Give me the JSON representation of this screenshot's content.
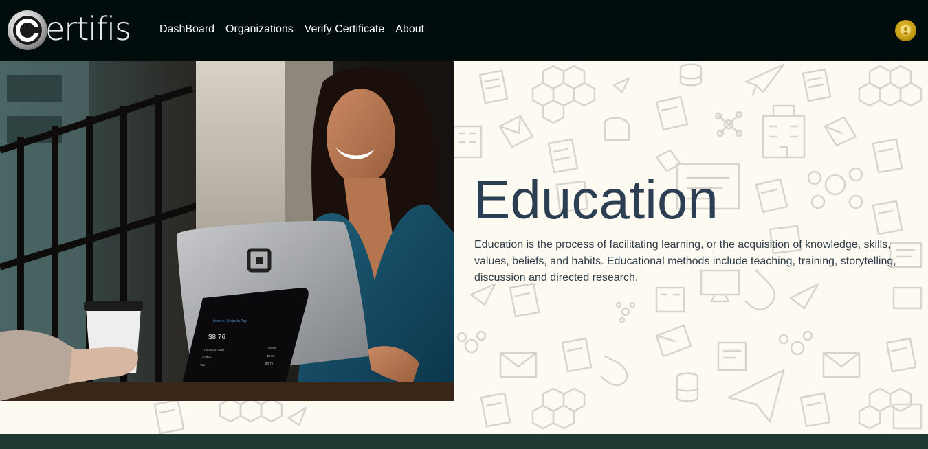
{
  "brand": {
    "logo_text": "ertifis",
    "logo_letter": "C"
  },
  "nav": {
    "items": [
      {
        "label": "DashBoard"
      },
      {
        "label": "Organizations"
      },
      {
        "label": "Verify Certificate"
      },
      {
        "label": "About"
      }
    ]
  },
  "hero": {
    "title": "Education",
    "description": "Education is the process of facilitating learning, or the acquisition of knowledge, skills, values, beliefs, and habits. Educational methods include teaching, training, storytelling, discussion and directed research.",
    "screen_header": "Insert or Swipe to Pay",
    "screen_amount": "$8.76",
    "screen_items": [
      {
        "name": "Avocado Toast",
        "price": "$5.50"
      },
      {
        "name": "Coffee",
        "price": "$2.50"
      },
      {
        "name": "Tax",
        "price": "$0.76"
      }
    ]
  },
  "icons": {
    "avatar": "user-shield-icon",
    "logo": "certifis-logo-icon"
  },
  "colors": {
    "navbar_bg": "#010d0c",
    "content_bg": "#fdfbf1",
    "heading": "#2c3e52",
    "footer_bar": "#1d3b33",
    "avatar_gold": "#d4ac1f"
  }
}
